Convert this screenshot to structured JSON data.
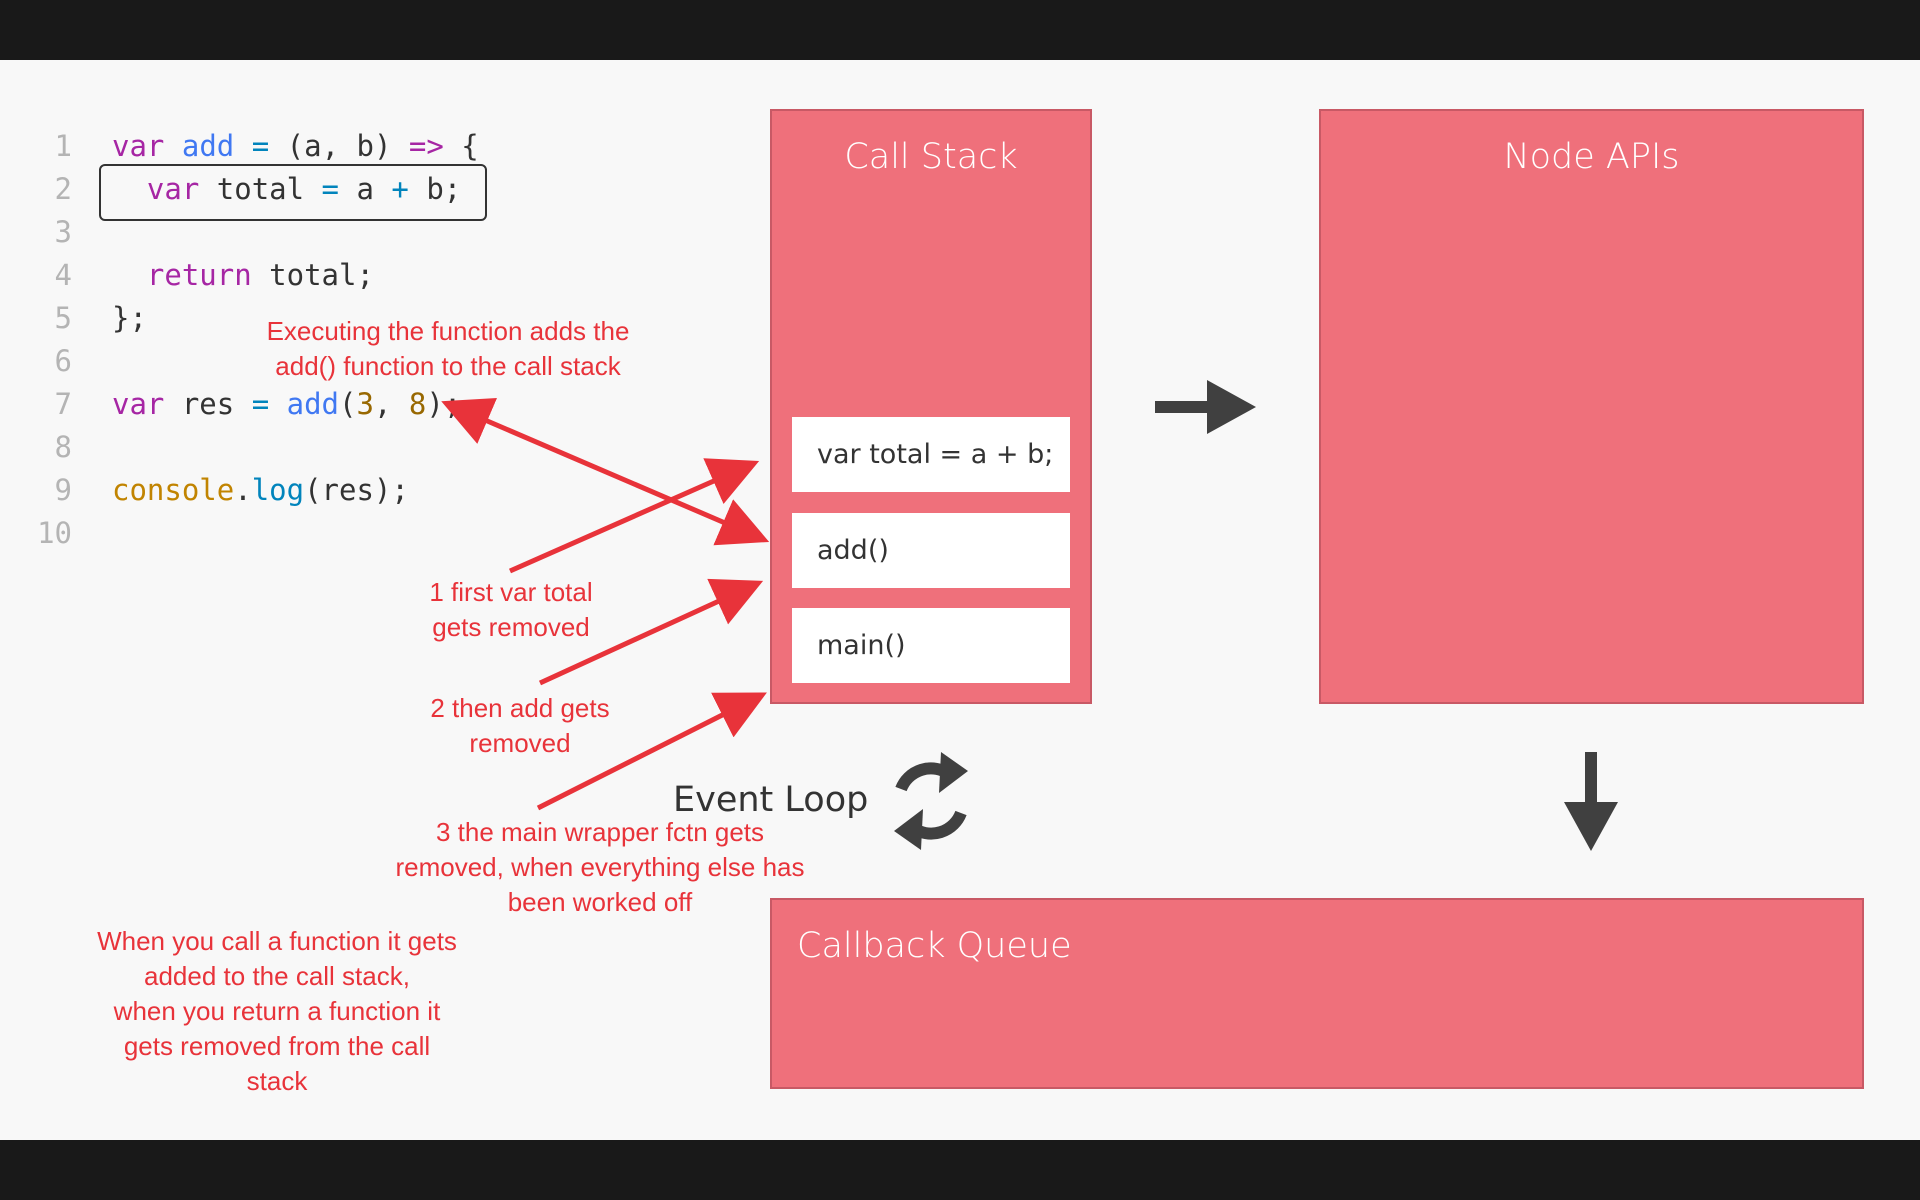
{
  "code": {
    "lines": [
      {
        "n": "1",
        "tokens": [
          [
            "kw",
            "var"
          ],
          [
            "plain",
            " "
          ],
          [
            "fn",
            "add"
          ],
          [
            "plain",
            " "
          ],
          [
            "op",
            "="
          ],
          [
            "plain",
            " (a, b) "
          ],
          [
            "kw",
            "=>"
          ],
          [
            "plain",
            " {"
          ]
        ]
      },
      {
        "n": "2",
        "tokens": [
          [
            "plain",
            "  "
          ],
          [
            "kw",
            "var"
          ],
          [
            "plain",
            " total "
          ],
          [
            "op",
            "="
          ],
          [
            "plain",
            " a "
          ],
          [
            "op",
            "+"
          ],
          [
            "plain",
            " b;"
          ]
        ]
      },
      {
        "n": "3",
        "tokens": []
      },
      {
        "n": "4",
        "tokens": [
          [
            "plain",
            "  "
          ],
          [
            "kw",
            "return"
          ],
          [
            "plain",
            " total;"
          ]
        ]
      },
      {
        "n": "5",
        "tokens": [
          [
            "plain",
            "};"
          ]
        ]
      },
      {
        "n": "6",
        "tokens": []
      },
      {
        "n": "7",
        "tokens": [
          [
            "kw",
            "var"
          ],
          [
            "plain",
            " res "
          ],
          [
            "op",
            "="
          ],
          [
            "plain",
            " "
          ],
          [
            "fn",
            "add"
          ],
          [
            "plain",
            "("
          ],
          [
            "num",
            "3"
          ],
          [
            "plain",
            ", "
          ],
          [
            "num",
            "8"
          ],
          [
            "plain",
            ");"
          ]
        ]
      },
      {
        "n": "8",
        "tokens": []
      },
      {
        "n": "9",
        "tokens": [
          [
            "obj",
            "console"
          ],
          [
            "plain",
            "."
          ],
          [
            "op",
            "log"
          ],
          [
            "plain",
            "(res);"
          ]
        ]
      },
      {
        "n": "10",
        "tokens": []
      }
    ],
    "highlighted_line": "2"
  },
  "call_stack": {
    "title": "Call Stack",
    "frames": [
      "var total = a + b;",
      "add()",
      "main()"
    ]
  },
  "node_apis": {
    "title": "Node APIs"
  },
  "event_loop": {
    "label": "Event Loop"
  },
  "callback_queue": {
    "title": "Callback Queue"
  },
  "annotations": {
    "executing": [
      "Executing the function adds the",
      "add() function to the call stack"
    ],
    "step1": [
      "1 first var total",
      "gets removed"
    ],
    "step2": [
      "2 then add gets",
      "removed"
    ],
    "step3": [
      "3 the main wrapper fctn gets",
      "removed, when everything else has",
      "been worked off"
    ],
    "summary": [
      "When you call a function it gets",
      "added to the call stack,",
      "when you return a function it",
      "gets removed from the call",
      "stack"
    ]
  },
  "colors": {
    "panel": "#ef707b",
    "annotation": "#e8333a",
    "bars": "#191919",
    "background": "#f8f8f8"
  }
}
